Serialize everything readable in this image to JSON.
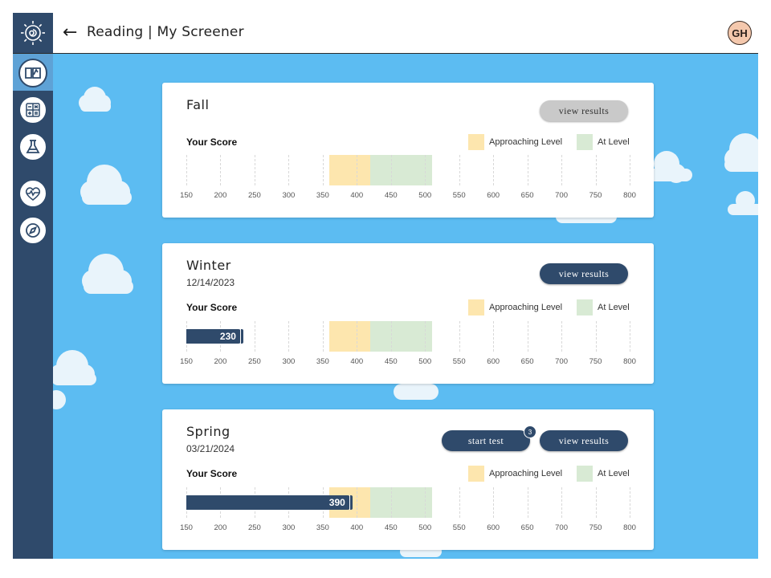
{
  "header": {
    "title": "Reading | My Screener",
    "avatar_initials": "GH",
    "back_icon": "arrow-left-icon",
    "logo_icon": "sun-spiral-logo"
  },
  "sidebar": {
    "items": [
      {
        "name": "reading",
        "icon": "open-book-icon",
        "active": true
      },
      {
        "name": "math",
        "icon": "calculator-icon",
        "active": false
      },
      {
        "name": "science",
        "icon": "flask-icon",
        "active": false
      },
      {
        "name": "health",
        "icon": "heart-pulse-icon",
        "active": false
      },
      {
        "name": "explore",
        "icon": "compass-icon",
        "active": false
      }
    ]
  },
  "scale": {
    "ticks": [
      "150",
      "200",
      "250",
      "300",
      "350",
      "400",
      "450",
      "500",
      "550",
      "600",
      "650",
      "700",
      "750",
      "800"
    ],
    "min": 150,
    "max": 800,
    "approaching": {
      "from": 360,
      "to": 420,
      "color": "#fde6ae",
      "label": "Approaching Level"
    },
    "at_level": {
      "from": 420,
      "to": 510,
      "color": "#d8ead4",
      "label": "At Level"
    }
  },
  "colors": {
    "navy": "#2f4a6b",
    "sky": "#5cbcf2"
  },
  "cards": [
    {
      "season": "Fall",
      "date": "",
      "your_score_label": "Your Score",
      "score": null,
      "score_label": "",
      "view_results_label": "view results",
      "view_results_enabled": false,
      "start_test_label": "",
      "badge": ""
    },
    {
      "season": "Winter",
      "date": "12/14/2023",
      "your_score_label": "Your Score",
      "score": 230,
      "score_label": "230",
      "view_results_label": "view results",
      "view_results_enabled": true,
      "start_test_label": "",
      "badge": ""
    },
    {
      "season": "Spring",
      "date": "03/21/2024",
      "your_score_label": "Your Score",
      "score": 390,
      "score_label": "390",
      "view_results_label": "view results",
      "view_results_enabled": true,
      "start_test_label": "start test",
      "badge": "3"
    }
  ]
}
